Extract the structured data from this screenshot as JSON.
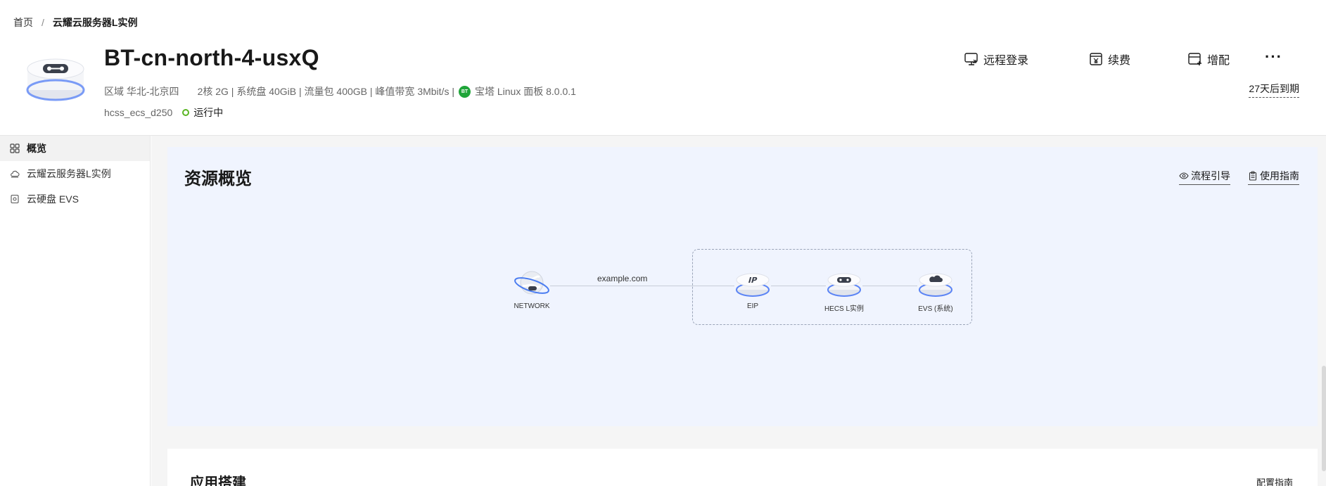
{
  "breadcrumb": {
    "home": "首页",
    "separator": "/",
    "current": "云耀云服务器L实例"
  },
  "instance": {
    "name": "BT-cn-north-4-usxQ",
    "region": "区域 华北-北京四",
    "specs": "2核  2G | 系统盘 40GiB | 流量包 400GB | 峰值带宽 3Mbit/s |",
    "bt_badge": "BT",
    "image": "宝塔 Linux 面板 8.0.0.1",
    "flavor": "hcss_ecs_d250",
    "status": "运行中",
    "status_color": "#5ab524"
  },
  "actions": {
    "remote_login": "远程登录",
    "renew": "续费",
    "upgrade": "增配",
    "more": "···"
  },
  "expire": "27天后到期",
  "sidebar": {
    "items": [
      {
        "label": "概览",
        "icon": "grid-icon",
        "active": true
      },
      {
        "label": "云耀云服务器L实例",
        "icon": "cloud-icon",
        "active": false
      },
      {
        "label": "云硬盘 EVS",
        "icon": "disk-icon",
        "active": false
      }
    ]
  },
  "overview": {
    "title": "资源概览",
    "flow_guide": "流程引导",
    "usage_guide": "使用指南",
    "diagram": {
      "edge_label": "example.com",
      "nodes": [
        "NETWORK",
        "EIP",
        "HECS L实例",
        "EVS (系统)"
      ]
    }
  },
  "app_build": {
    "title": "应用搭建",
    "config_guide": "配置指南"
  },
  "colors": {
    "accent": "#526ecc",
    "card_bg": "#f0f4fe",
    "bt_green": "#20a53a"
  }
}
